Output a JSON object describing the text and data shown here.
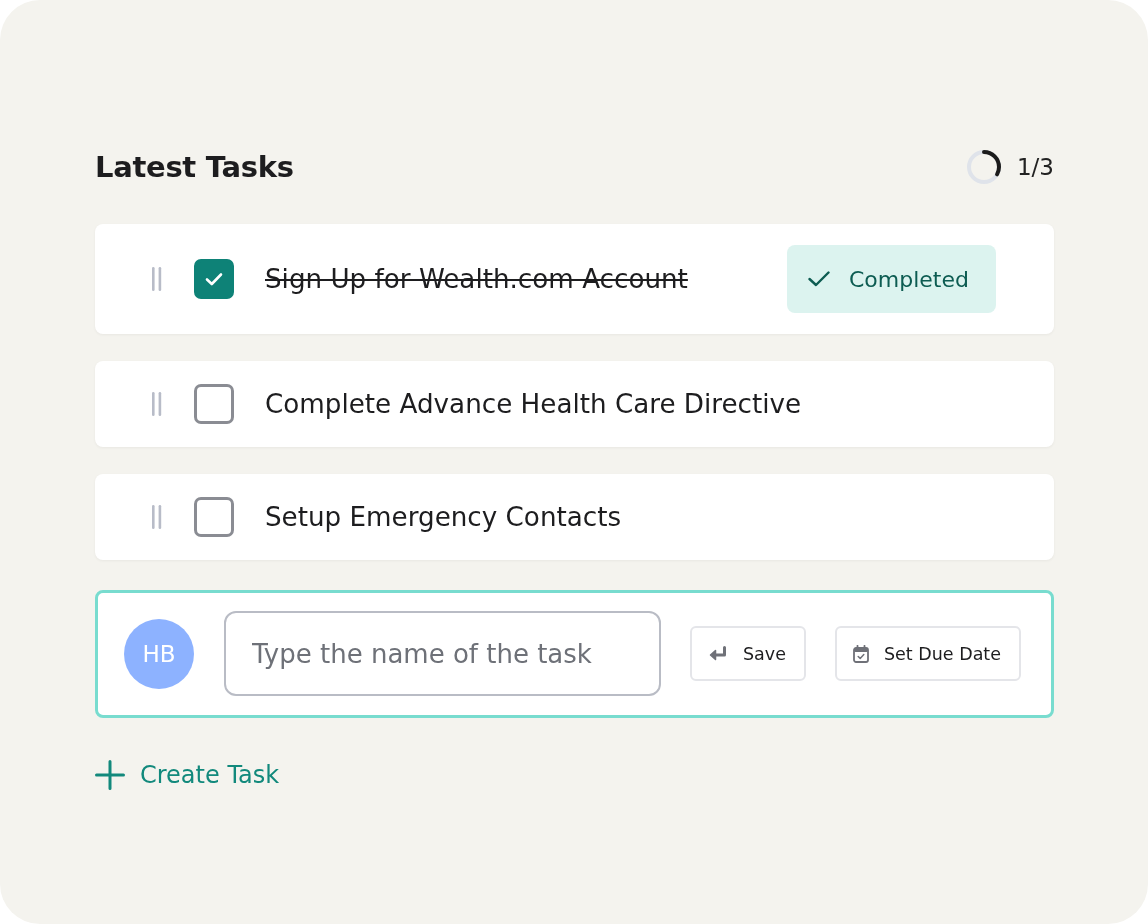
{
  "header": {
    "title": "Latest Tasks",
    "progress": {
      "level": 0.33,
      "label": "1/3"
    }
  },
  "tasks": [
    {
      "title": "Sign Up for Wealth.com Account",
      "checked": true,
      "status": "Completed"
    },
    {
      "title": "Complete Advance Health Care Directive",
      "checked": false
    },
    {
      "title": "Setup Emergency Contacts",
      "checked": false
    }
  ],
  "composer": {
    "avatar": "HB",
    "input": {
      "placeholder": "Type the name of the task"
    },
    "buttons": [
      {
        "kind": "save",
        "label": "Save"
      },
      {
        "kind": "due-date",
        "label": "Set Due Date"
      }
    ]
  },
  "create_task": {
    "label": "Create Task"
  }
}
